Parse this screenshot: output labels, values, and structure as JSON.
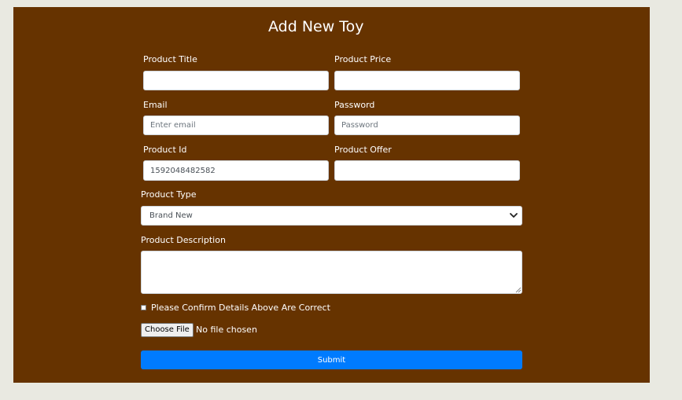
{
  "form": {
    "heading": "Add New Toy",
    "product_title": {
      "label": "Product Title",
      "value": "",
      "placeholder": ""
    },
    "product_price": {
      "label": "Product Price",
      "value": "",
      "placeholder": ""
    },
    "email": {
      "label": "Email",
      "value": "",
      "placeholder": "Enter email"
    },
    "password": {
      "label": "Password",
      "value": "",
      "placeholder": "Password"
    },
    "product_id": {
      "label": "Product Id",
      "value": "1592048482582",
      "placeholder": ""
    },
    "product_offer": {
      "label": "Product Offer",
      "value": "",
      "placeholder": ""
    },
    "product_type": {
      "label": "Product Type",
      "selected": "Brand New"
    },
    "product_description": {
      "label": "Product Description",
      "value": ""
    },
    "confirm": {
      "label": "Please Confirm Details Above Are Correct",
      "checked": false
    },
    "file": {
      "button_label": "Choose File",
      "status": "No file chosen"
    },
    "submit_label": "Submit"
  },
  "icons": {
    "select_arrow": "chevron-down-icon",
    "textarea_resize": "resize-grip-icon"
  },
  "colors": {
    "page_background": "#e9e9e1",
    "panel_background": "#663300",
    "submit_background": "#007bff"
  }
}
